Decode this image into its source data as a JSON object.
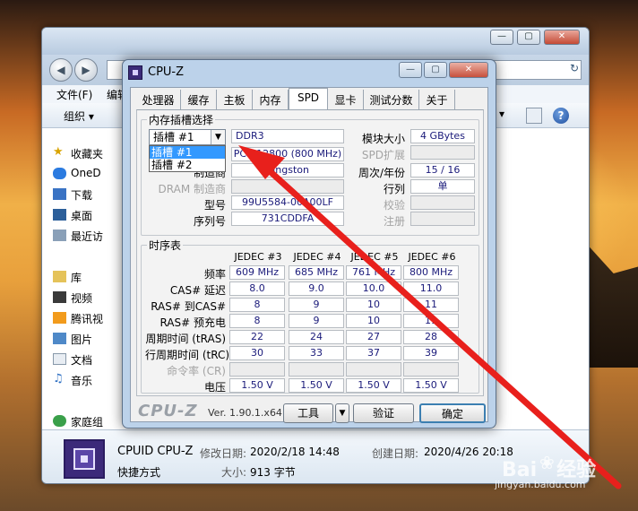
{
  "explorer": {
    "menu": [
      "文件(F)",
      "编辑"
    ],
    "organize_label": "组织",
    "sidebar": [
      {
        "label": "收藏夹",
        "icon": "star-icon"
      },
      {
        "label": "OneD",
        "icon": "cloud-icon"
      },
      {
        "label": "下载",
        "icon": "download-icon"
      },
      {
        "label": "桌面",
        "icon": "desktop-icon"
      },
      {
        "label": "最近访",
        "icon": "recent-icon"
      },
      {
        "label": "库",
        "icon": "library-icon"
      },
      {
        "label": "视频",
        "icon": "video-icon"
      },
      {
        "label": "腾讯视",
        "icon": "tencent-video-icon"
      },
      {
        "label": "图片",
        "icon": "picture-icon"
      },
      {
        "label": "文档",
        "icon": "document-icon"
      },
      {
        "label": "音乐",
        "icon": "music-icon"
      },
      {
        "label": "家庭组",
        "icon": "homegroup-icon"
      }
    ],
    "details": {
      "name": "CPUID CPU-Z",
      "type": "快捷方式",
      "modified_label": "修改日期:",
      "modified_value": "2020/2/18 14:48",
      "created_label": "创建日期:",
      "created_value": "2020/4/26 20:18",
      "size_label": "大小:",
      "size_value": "913 字节"
    }
  },
  "cpuz": {
    "title": "CPU-Z",
    "tabs": [
      "处理器",
      "缓存",
      "主板",
      "内存",
      "SPD",
      "显卡",
      "测试分数",
      "关于"
    ],
    "active_tab": "SPD",
    "slot_group_title": "内存插槽选择",
    "slot_selected": "插槽 #1",
    "slot_options": [
      "插槽 #1",
      "插槽 #2"
    ],
    "mem_type": "DDR3",
    "module_speed": "PC3-12800 (800 MHz)",
    "manufacturer_label": "制造商",
    "manufacturer": "Kingston",
    "dram_mfr_label": "DRAM 制造商",
    "part_label": "型号",
    "part_value": "99U5584-00",
    "part_value_tail": "A00LF",
    "serial_label": "序列号",
    "serial_value": "731CDDFA",
    "module_size_label": "模块大小",
    "module_size": "4 GBytes",
    "spd_ext_label": "SPD扩展",
    "week_year_label": "周次/年份",
    "week_year": "15 / 16",
    "rank_label": "行列",
    "rank": "单",
    "check_label": "校验",
    "reg_label": "注册",
    "timing_group_title": "时序表",
    "timing_columns": [
      "JEDEC #3",
      "JEDEC #4",
      "JEDEC #5",
      "JEDEC #6"
    ],
    "timing_rows": [
      {
        "label": "频率",
        "values": [
          "609 MHz",
          "685 MHz",
          "761 MHz",
          "800 MHz"
        ],
        "dim": false
      },
      {
        "label": "CAS# 延迟",
        "values": [
          "8.0",
          "9.0",
          "10.0",
          "11.0"
        ],
        "dim": false
      },
      {
        "label": "RAS# 到CAS#",
        "values": [
          "8",
          "9",
          "10",
          "11"
        ],
        "dim": false
      },
      {
        "label": "RAS# 预充电",
        "values": [
          "8",
          "9",
          "10",
          "11"
        ],
        "dim": false
      },
      {
        "label": "周期时间 (tRAS)",
        "values": [
          "22",
          "24",
          "27",
          "28"
        ],
        "dim": false
      },
      {
        "label": "行周期时间 (tRC)",
        "values": [
          "30",
          "33",
          "37",
          "39"
        ],
        "dim": false
      },
      {
        "label": "命令率 (CR)",
        "values": [
          "",
          "",
          "",
          ""
        ],
        "dim": true
      },
      {
        "label": "电压",
        "values": [
          "1.50 V",
          "1.50 V",
          "1.50 V",
          "1.50 V"
        ],
        "dim": false
      }
    ],
    "brand": "CPU-Z",
    "version": "Ver. 1.90.1.x64",
    "tools_label": "工具",
    "validate_label": "验证",
    "ok_label": "确定"
  },
  "watermark": {
    "text": "Bai",
    "text2": "经验",
    "sub": "jingyan.baidu.com"
  },
  "colors": {
    "arrow": "#e8201c",
    "value_text": "#1a1a7a",
    "selection": "#3399ff"
  }
}
